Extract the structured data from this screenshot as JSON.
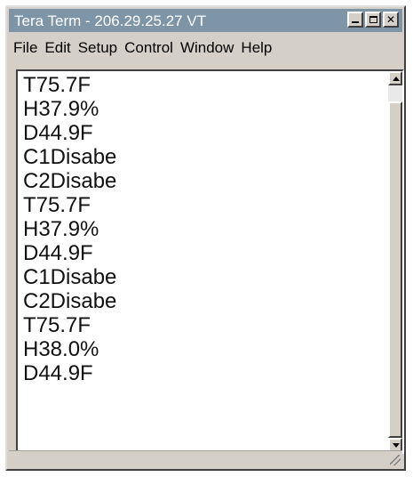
{
  "window": {
    "title": "Tera Term - 206.29.25.27 VT"
  },
  "title_buttons": [
    "minimize-icon",
    "maximize-icon",
    "close-icon"
  ],
  "menu": [
    "File",
    "Edit",
    "Setup",
    "Control",
    "Window",
    "Help"
  ],
  "terminal": {
    "lines": [
      "T75.7F",
      "H37.9%",
      "D44.9F",
      "C1Disabe",
      "C2Disabe",
      "T75.7F",
      "H37.9%",
      "D44.9F",
      "C1Disabe",
      "C2Disabe",
      "T75.7F",
      "H38.0%",
      "D44.9F"
    ]
  },
  "colors": {
    "titlebar": "#7e95a8",
    "window": "#d4d0c8",
    "terminal_bg": "#ffffff",
    "text": "#111111"
  }
}
